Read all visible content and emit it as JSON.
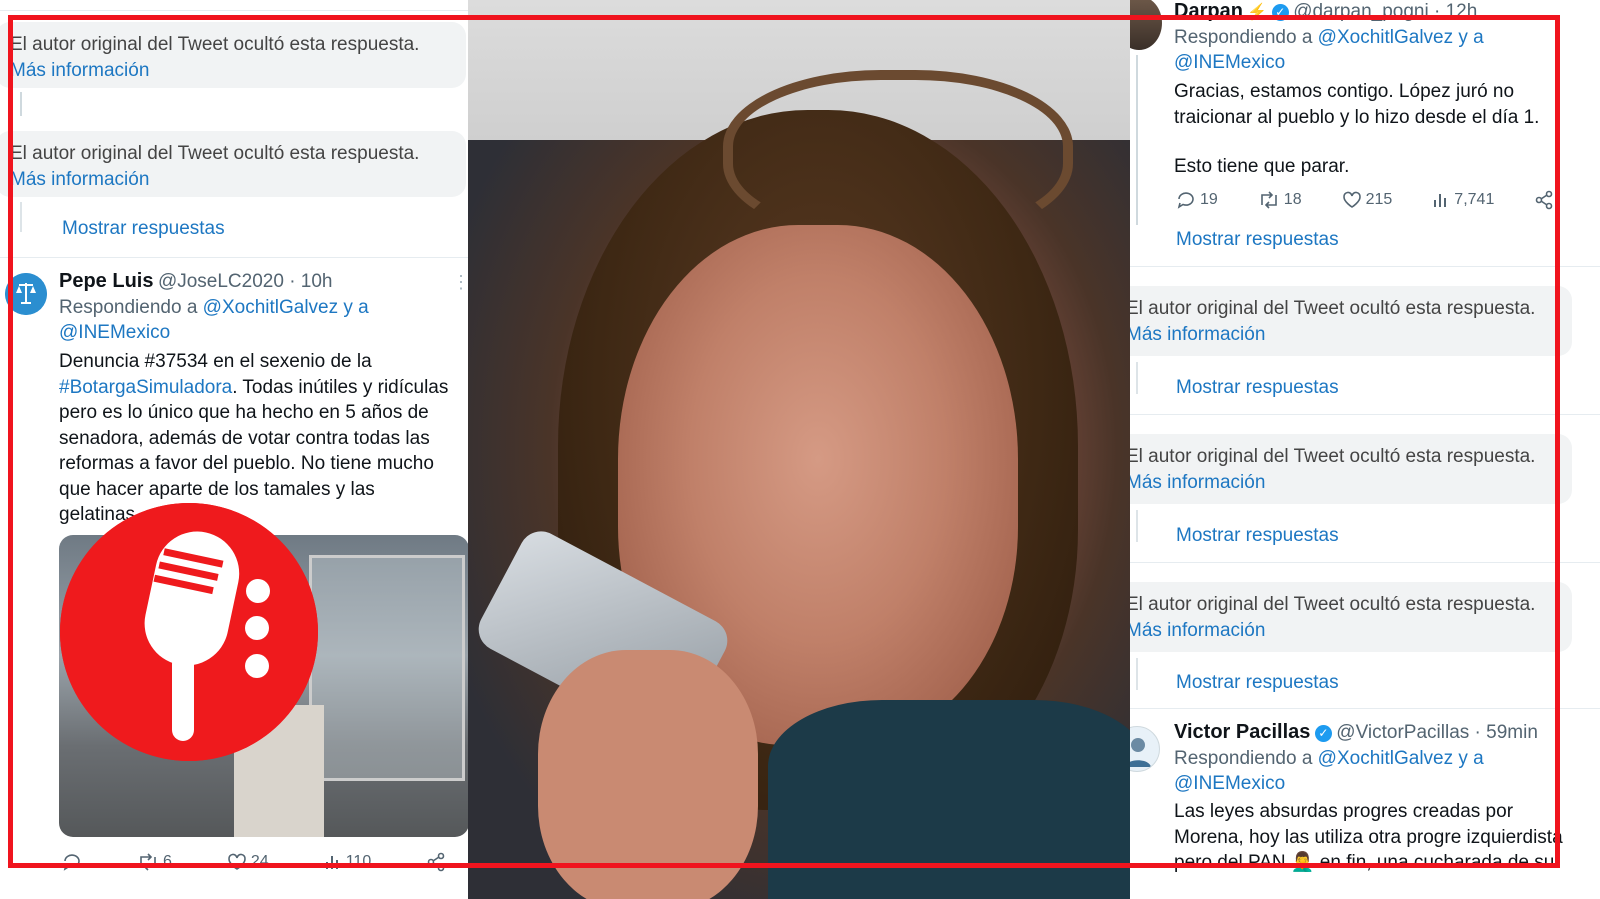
{
  "hidden_reply_text": "El autor original del Tweet ocultó esta respuesta.",
  "more_info_label": "Más información",
  "show_replies_label": "Mostrar respuestas",
  "left": {
    "tweet": {
      "name": "Pepe Luis",
      "handle_time": "@JoseLC2020 · 10h",
      "replying_prefix": "Respondiendo a",
      "replying_mentions": "@XochitlGalvez y a",
      "replying_mention2": "@INEMexico",
      "text_lines": [
        "Denuncia #37534 en el sexenio de la",
        "#BotargaSimuladora",
        ". Todas inútiles y ridículas",
        "pero es lo único que ha hecho en 5 años de",
        "senadora, además de votar contra todas las",
        "reformas a favor del pueblo. No tiene mucho",
        "que hacer aparte de los tamales y las",
        "gelatinas"
      ],
      "actions": {
        "retweets": "6",
        "likes": "24",
        "views": "110"
      }
    }
  },
  "right": {
    "tweet1": {
      "name": "Darpan",
      "handle_time": "@darpan_pogni · 12h",
      "replying_prefix": "Respondiendo a",
      "replying_mentions": "@XochitlGalvez y a",
      "replying_mention2": "@INEMexico",
      "text_lines": [
        "Gracias, estamos contigo. López juró no",
        "traicionar al pueblo y lo hizo desde el día 1.",
        "",
        "Esto tiene que parar."
      ],
      "actions": {
        "replies": "19",
        "retweets": "18",
        "likes": "215",
        "views": "7,741"
      }
    },
    "tweet2": {
      "name": "Victor Pacillas",
      "handle_time": "@VictorPacillas · 59min",
      "replying_prefix": "Respondiendo a",
      "replying_mentions": "@XochitlGalvez y a",
      "replying_mention2": "@INEMexico",
      "text_lines": [
        "Las leyes absurdas progres creadas por",
        "Morena, hoy las utiliza otra progre izquierdista",
        "pero del PAN 🤦‍♂️ en fin, una cucharada de su"
      ]
    }
  },
  "colors": {
    "accent": "#1d77c2",
    "frame": "#f0141e",
    "logo": "#ef1a1d"
  }
}
